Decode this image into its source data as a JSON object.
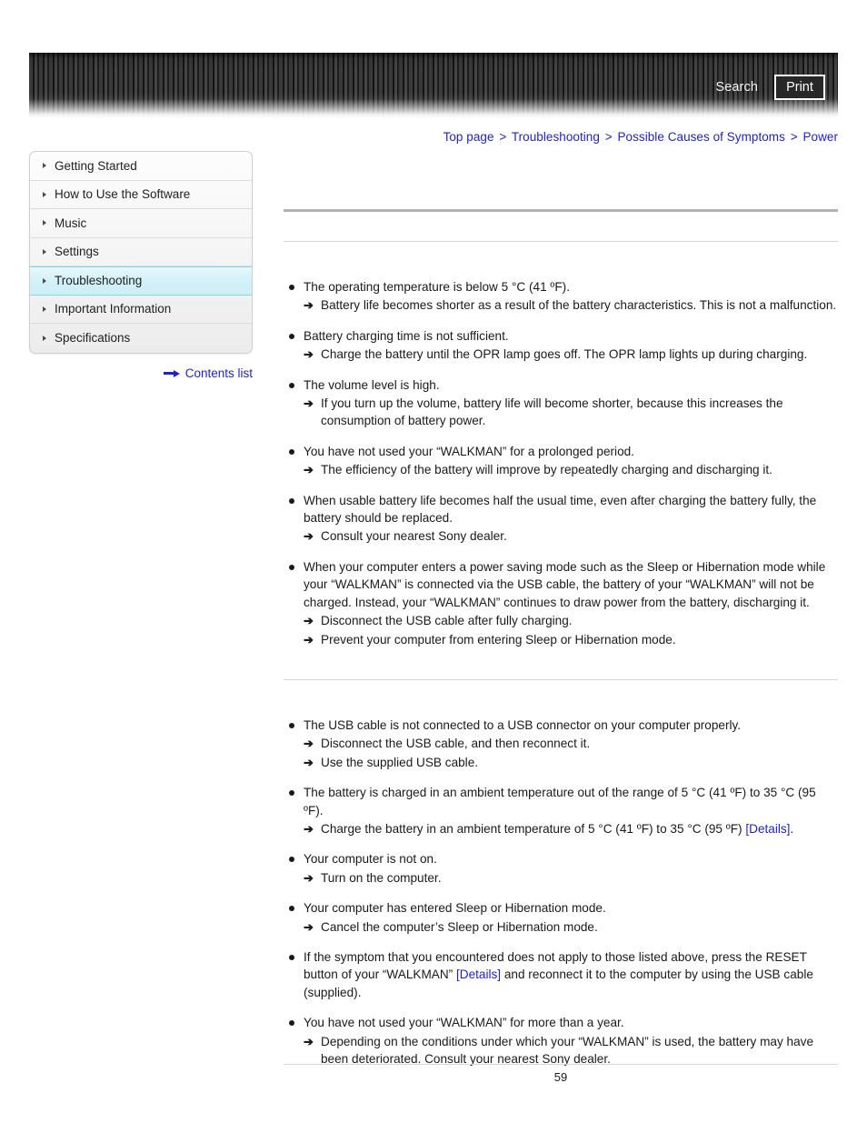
{
  "header": {
    "search_label": "Search",
    "print_label": "Print",
    "accent_color": "#2222cc"
  },
  "breadcrumb": {
    "separator": ">",
    "items": [
      {
        "label": "Top page"
      },
      {
        "label": "Troubleshooting"
      },
      {
        "label": "Possible Causes of Symptoms"
      },
      {
        "label": "Power"
      }
    ]
  },
  "sidebar": {
    "items": [
      {
        "label": "Getting Started",
        "active": false
      },
      {
        "label": "How to Use the Software",
        "active": false
      },
      {
        "label": "Music",
        "active": false
      },
      {
        "label": "Settings",
        "active": false
      },
      {
        "label": "Troubleshooting",
        "active": true
      },
      {
        "label": "Important Information",
        "active": false
      },
      {
        "label": "Specifications",
        "active": false
      }
    ],
    "contents_list_label": "Contents list",
    "highlight_color": "#d2f1f8"
  },
  "main": {
    "section_one": {
      "title": "",
      "subtitle": "",
      "bullets": [
        {
          "text": "The operating temperature is below 5 °C (41 ºF).",
          "arrows": [
            "Battery life becomes shorter as a result of the battery characteristics. This is not a malfunction."
          ]
        },
        {
          "text": "Battery charging time is not sufficient.",
          "arrows": [
            "Charge the battery until the OPR lamp goes off. The OPR lamp lights up during charging."
          ]
        },
        {
          "text": "The volume level is high.",
          "arrows": [
            "If you turn up the volume, battery life will become shorter, because this increases the consumption of battery power."
          ]
        },
        {
          "text": "You have not used your “WALKMAN” for a prolonged period.",
          "arrows": [
            "The efficiency of the battery will improve by repeatedly charging and discharging it."
          ]
        },
        {
          "text": "When usable battery life becomes half the usual time, even after charging the battery fully, the battery should be replaced.",
          "arrows": [
            "Consult your nearest Sony dealer."
          ]
        },
        {
          "text": "When your computer enters a power saving mode such as the Sleep or Hibernation mode while your “WALKMAN” is connected via the USB cable, the battery of your “WALKMAN” will not be charged. Instead, your “WALKMAN” continues to draw power from the battery, discharging it.",
          "arrows": [
            "Disconnect the USB cable after fully charging.",
            "Prevent your computer from entering Sleep or Hibernation mode."
          ]
        }
      ]
    },
    "section_two": {
      "subtitle": "",
      "bullets": [
        {
          "text": "The USB cable is not connected to a USB connector on your computer properly.",
          "arrows": [
            "Disconnect the USB cable, and then reconnect it.",
            "Use the supplied USB cable."
          ]
        },
        {
          "text": "The battery is charged in an ambient temperature out of the range of 5 °C (41 ºF) to 35 °C (95 ºF).",
          "arrows_rich": [
            {
              "before": "Charge the battery in an ambient temperature of 5 °C (41 ºF) to 35 °C (95 ºF) ",
              "link": "[Details]",
              "after": "."
            }
          ]
        },
        {
          "text": "Your computer is not on.",
          "arrows": [
            "Turn on the computer."
          ]
        },
        {
          "text": "Your computer has entered Sleep or Hibernation mode.",
          "arrows": [
            "Cancel the computer’s Sleep or Hibernation mode."
          ]
        },
        {
          "text_rich": {
            "before": "If the symptom that you encountered does not apply to those listed above, press the RESET button of your “WALKMAN” ",
            "link": "[Details]",
            "after": " and reconnect it to the computer by using the USB cable (supplied)."
          },
          "arrows": []
        },
        {
          "text": "You have not used your “WALKMAN” for more than a year.",
          "arrows": [
            "Depending on the conditions under which your “WALKMAN” is used, the battery may have been deteriorated. Consult your nearest Sony dealer."
          ]
        }
      ]
    },
    "arrow_glyph": "➔"
  },
  "footer": {
    "page_number": "59"
  }
}
